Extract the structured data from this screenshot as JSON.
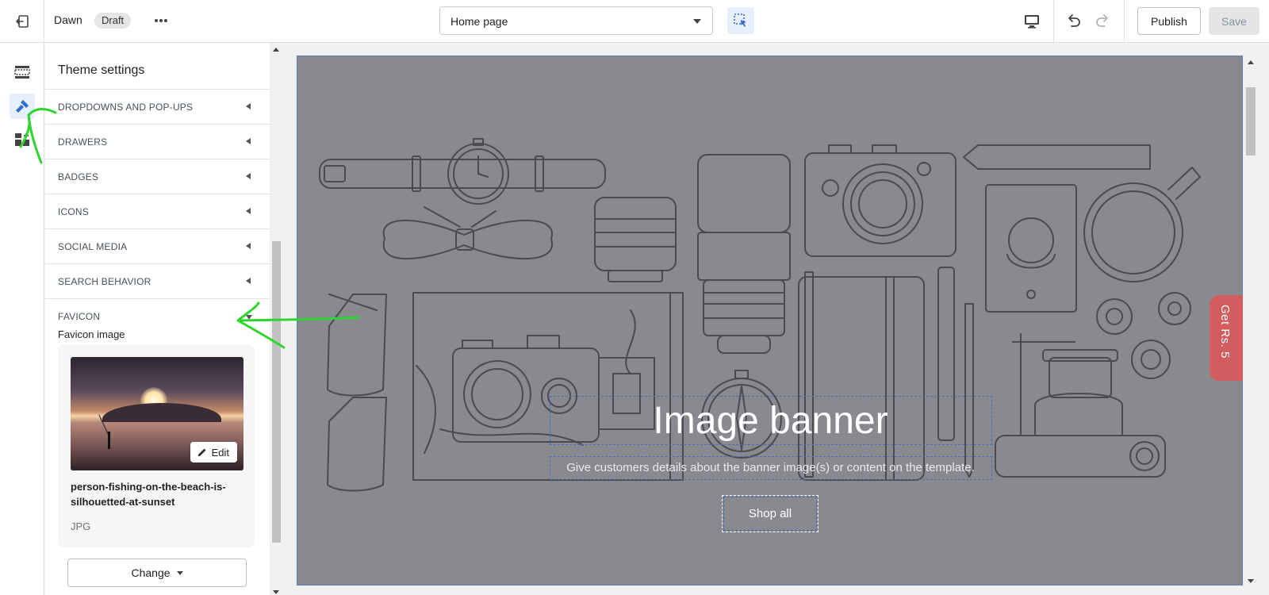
{
  "topbar": {
    "theme_name": "Dawn",
    "status_badge": "Draft",
    "page_selector": "Home page",
    "publish_label": "Publish",
    "save_label": "Save"
  },
  "rail": {
    "items": [
      "sections-icon",
      "theme-settings-icon",
      "apps-icon"
    ],
    "active": "theme-settings-icon"
  },
  "panel": {
    "title": "Theme settings",
    "sections": [
      {
        "label": "DROPDOWNS AND POP-UPS"
      },
      {
        "label": "DRAWERS"
      },
      {
        "label": "BADGES"
      },
      {
        "label": "ICONS"
      },
      {
        "label": "SOCIAL MEDIA"
      },
      {
        "label": "SEARCH BEHAVIOR"
      },
      {
        "label": "FAVICON"
      }
    ],
    "favicon": {
      "field_label": "Favicon image",
      "edit_label": "Edit",
      "file_name": "person-fishing-on-the-beach-is-silhouetted-at-sunset",
      "file_type": "JPG",
      "change_label": "Change"
    }
  },
  "preview": {
    "banner_title": "Image banner",
    "banner_subtitle": "Give customers details about the banner image(s) or content on the template.",
    "button_label": "Shop all",
    "promo_tab": "Get Rs. 5",
    "accent": "#d35c5e"
  },
  "colors": {
    "accent_blue": "#2c6ecb",
    "annotation_green": "#2ed52e",
    "preview_bg": "#898a8f"
  }
}
